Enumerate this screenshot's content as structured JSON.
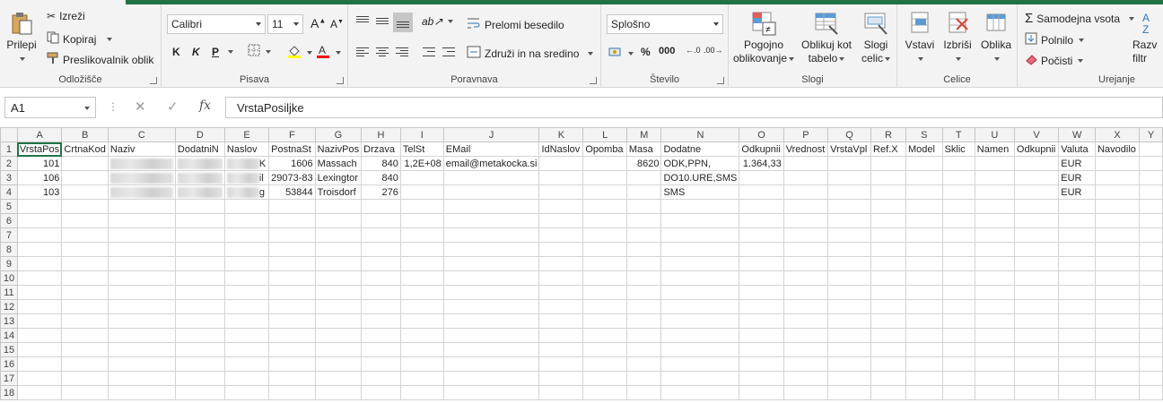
{
  "ribbon": {
    "clipboard": {
      "paste": "Prilepi",
      "cut": "Izreži",
      "copy": "Kopiraj",
      "format_painter": "Preslikovalnik oblik",
      "label": "Odložišče"
    },
    "font": {
      "name": "Calibri",
      "size": "11",
      "bold": "K",
      "italic": "K",
      "underline": "P",
      "label": "Pisava"
    },
    "alignment": {
      "wrap": "Prelomi besedilo",
      "merge": "Združi in na sredino",
      "label": "Poravnava"
    },
    "number": {
      "format": "Splošno",
      "percent": "%",
      "thousands": "000",
      "label": "Število"
    },
    "styles": {
      "conditional": "Pogojno",
      "conditional2": "oblikovanje",
      "table": "Oblikuj kot",
      "table2": "tabelo",
      "cell_styles": "Slogi",
      "cell_styles2": "celic",
      "label": "Slogi"
    },
    "cells": {
      "insert": "Vstavi",
      "delete": "Izbriši",
      "format": "Oblika",
      "label": "Celice"
    },
    "editing": {
      "autosum": "Samodejna vsota",
      "fill": "Polnilo",
      "clear": "Počisti",
      "sort": "Razv",
      "sort2": "filtr",
      "label": "Urejanje"
    }
  },
  "formula_bar": {
    "name_box": "A1",
    "fx": "fx",
    "content": "VrstaPosiljke"
  },
  "sheet": {
    "columns": [
      "A",
      "B",
      "C",
      "D",
      "E",
      "F",
      "G",
      "H",
      "I",
      "J",
      "K",
      "L",
      "M",
      "N",
      "O",
      "P",
      "Q",
      "R",
      "S",
      "T",
      "U",
      "V",
      "W",
      "X",
      "Y"
    ],
    "rows": [
      [
        "VrstaPos",
        "CrtnaKod",
        "Naziv",
        "DodatniN",
        "Naslov",
        "PostnaSt",
        "NazivPos",
        "Drzava",
        "TelSt",
        "EMail",
        "IdNaslov",
        "Opomba",
        "Masa",
        "Dodatne",
        "Odkupnii",
        "Vrednost",
        "VrstaVpl",
        "Ref.X",
        "Model",
        "Sklic",
        "Namen",
        "Odkupnii",
        "Valuta",
        "Navodilo",
        ""
      ],
      [
        "101",
        "",
        "",
        "",
        "K",
        "1606",
        "Massach",
        "840",
        "1,2E+08",
        "email@metakocka.si",
        "",
        "",
        "8620",
        "ODK,PPN,",
        "1.364,33",
        "",
        "",
        "",
        "",
        "",
        "",
        "",
        "EUR",
        "",
        ""
      ],
      [
        "106",
        "",
        "",
        "",
        "il",
        "29073-83",
        "Lexingtor",
        "840",
        "",
        "",
        "",
        "",
        "",
        "DO10.URE,SMS",
        "",
        "",
        "",
        "",
        "",
        "",
        "",
        "",
        "EUR",
        "",
        ""
      ],
      [
        "103",
        "",
        "",
        "",
        "g",
        "53844",
        "Troisdorf",
        "276",
        "",
        "",
        "",
        "",
        "",
        "SMS",
        "",
        "",
        "",
        "",
        "",
        "",
        "",
        "",
        "EUR",
        "",
        ""
      ]
    ],
    "row_numbers": [
      "1",
      "2",
      "3",
      "4",
      "5",
      "6",
      "7",
      "8",
      "9",
      "10",
      "11",
      "12",
      "13",
      "14",
      "15",
      "16",
      "17",
      "18"
    ]
  }
}
